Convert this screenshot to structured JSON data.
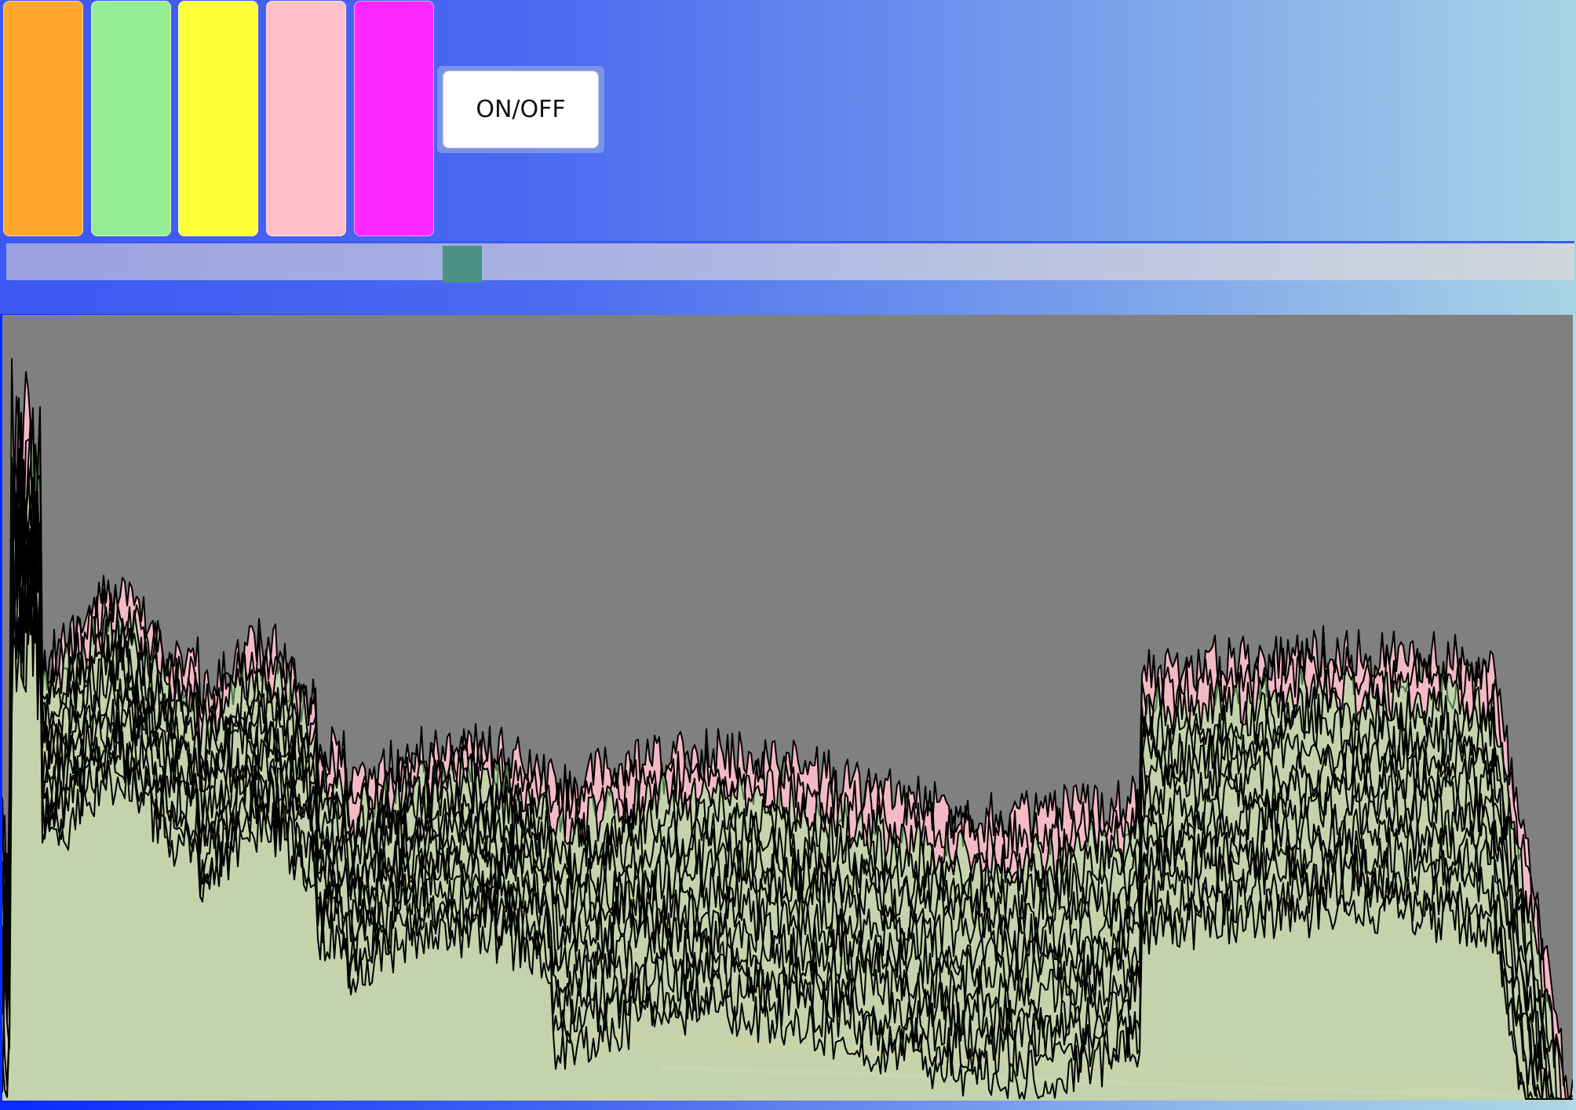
{
  "controls": {
    "swatches": [
      {
        "name": "orange",
        "color": "#ffa62e"
      },
      {
        "name": "light-green",
        "color": "#96ec93"
      },
      {
        "name": "yellow",
        "color": "#ffff3a"
      },
      {
        "name": "pink",
        "color": "#ffc0cc"
      },
      {
        "name": "magenta",
        "color": "#ff27ff"
      }
    ],
    "toggle_label": "ON/OFF",
    "slider": {
      "value_fraction": 0.291,
      "thumb_color": "#4b9384"
    }
  },
  "colors": {
    "plot_background": "#808080",
    "waveform_stroke": "#000000"
  },
  "visualizer": {
    "line_count": 14,
    "palette": [
      "#ffc0cc",
      "#96ec93",
      "#ffa62e",
      "#ffc0cc"
    ]
  }
}
